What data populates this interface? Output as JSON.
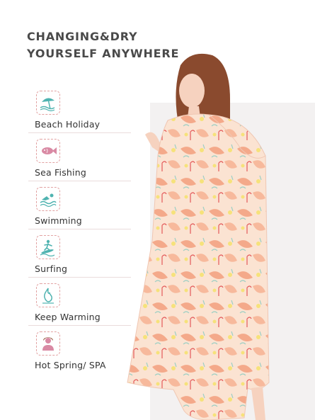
{
  "headline": {
    "line1": "CHANGING&DRY",
    "line2": "YOURSELF ANYWHERE"
  },
  "features": [
    {
      "label": "Beach Holiday",
      "icon": "beach-umbrella-icon"
    },
    {
      "label": "Sea Fishing",
      "icon": "fish-icon"
    },
    {
      "label": "Swimming",
      "icon": "swimmer-icon"
    },
    {
      "label": "Surfing",
      "icon": "surfer-icon"
    },
    {
      "label": "Keep Warming",
      "icon": "flame-icon"
    },
    {
      "label": "Hot Spring/ SPA",
      "icon": "spa-person-icon"
    }
  ],
  "colors": {
    "accent": "#e59a9a",
    "icon_teal": "#4fb3b0",
    "icon_pink": "#d98aa4",
    "panel": "#f3f1f1",
    "poncho_base": "#fbe3d2",
    "poncho_coral": "#f4a98a",
    "hair": "#8a4a2e"
  }
}
